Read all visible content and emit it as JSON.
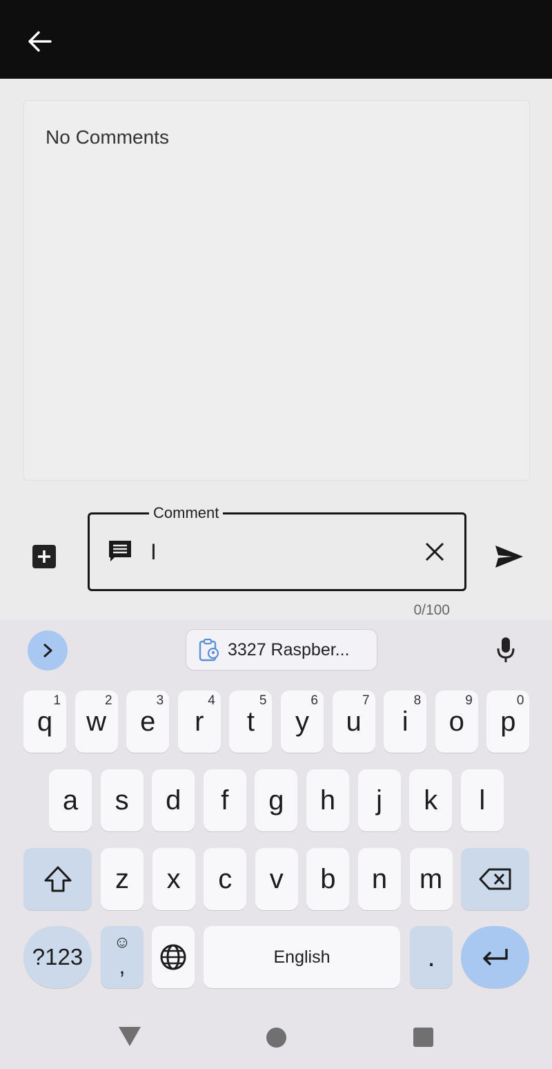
{
  "app_bar": {
    "back_icon": "arrow-left-icon"
  },
  "comments": {
    "empty_text": "No Comments"
  },
  "composer": {
    "add_icon": "plus-box-icon",
    "field_label": "Comment",
    "field_icon": "comment-icon",
    "input_value": "I",
    "clear_icon": "close-icon",
    "send_icon": "send-icon",
    "counter": "0/100"
  },
  "keyboard": {
    "suggestion_chip": "3327 Raspber...",
    "row1": [
      {
        "k": "q",
        "s": "1"
      },
      {
        "k": "w",
        "s": "2"
      },
      {
        "k": "e",
        "s": "3"
      },
      {
        "k": "r",
        "s": "4"
      },
      {
        "k": "t",
        "s": "5"
      },
      {
        "k": "y",
        "s": "6"
      },
      {
        "k": "u",
        "s": "7"
      },
      {
        "k": "i",
        "s": "8"
      },
      {
        "k": "o",
        "s": "9"
      },
      {
        "k": "p",
        "s": "0"
      }
    ],
    "row2": [
      "a",
      "s",
      "d",
      "f",
      "g",
      "h",
      "j",
      "k",
      "l"
    ],
    "row3": [
      "z",
      "x",
      "c",
      "v",
      "b",
      "n",
      "m"
    ],
    "sym_label": "?123",
    "comma": ",",
    "space_label": "English",
    "period": "."
  },
  "colors": {
    "app_bar": "#0e0e0e",
    "keyboard_bg": "#e6e4e9",
    "accent_key": "#a8c8f2",
    "mod_key": "#cbd9ea"
  }
}
